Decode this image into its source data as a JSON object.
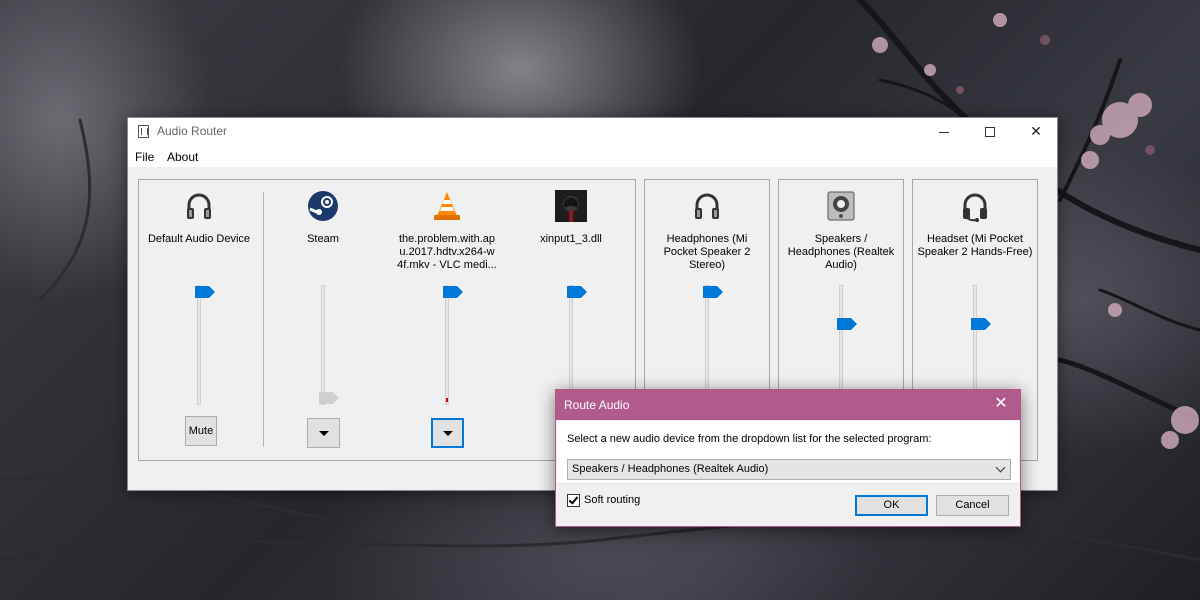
{
  "window": {
    "title": "Audio Router",
    "icon": "app-icon",
    "controls": {
      "minimize": "minimize-icon",
      "maximize": "maximize-icon",
      "close": "✕"
    }
  },
  "menu": {
    "items": [
      "File",
      "About"
    ]
  },
  "default_device": {
    "label": "Default Audio Device",
    "icon": "headphones-icon",
    "volume": 1.0,
    "mute_label": "Mute"
  },
  "programs": [
    {
      "label": "Steam",
      "icon": "steam-icon",
      "volume": 0.0,
      "route_icon": "dropdown-arrow-icon"
    },
    {
      "label": "the.problem.with.ap u.2017.hdtv.x264-w 4f.mkv - VLC medi...",
      "icon": "vlc-cone-icon",
      "volume": 1.0,
      "route_icon": "dropdown-arrow-icon"
    },
    {
      "label": "xinput1_3.dll",
      "icon": "app-avatar-icon",
      "volume": 1.0
    }
  ],
  "devices": [
    {
      "label": "Headphones (Mi Pocket Speaker 2 Stereo)",
      "icon": "headphones-icon",
      "volume": 1.0
    },
    {
      "label": "Speakers / Headphones (Realtek Audio)",
      "icon": "speaker-icon",
      "volume": 0.7
    },
    {
      "label": "Headset (Mi Pocket Speaker 2 Hands-Free)",
      "icon": "headset-icon",
      "volume": 0.7
    }
  ],
  "dialog": {
    "title": "Route Audio",
    "close": "✕",
    "instruction": "Select a new audio device from the dropdown list for the selected program:",
    "selected_device": "Speakers / Headphones (Realtek Audio)",
    "soft_routing_label": "Soft routing",
    "soft_routing_checked": true,
    "ok_label": "OK",
    "cancel_label": "Cancel"
  },
  "colors": {
    "accent": "#0078d7",
    "dialog_title": "#b15b8d",
    "window_bg": "#f0f0f0"
  }
}
